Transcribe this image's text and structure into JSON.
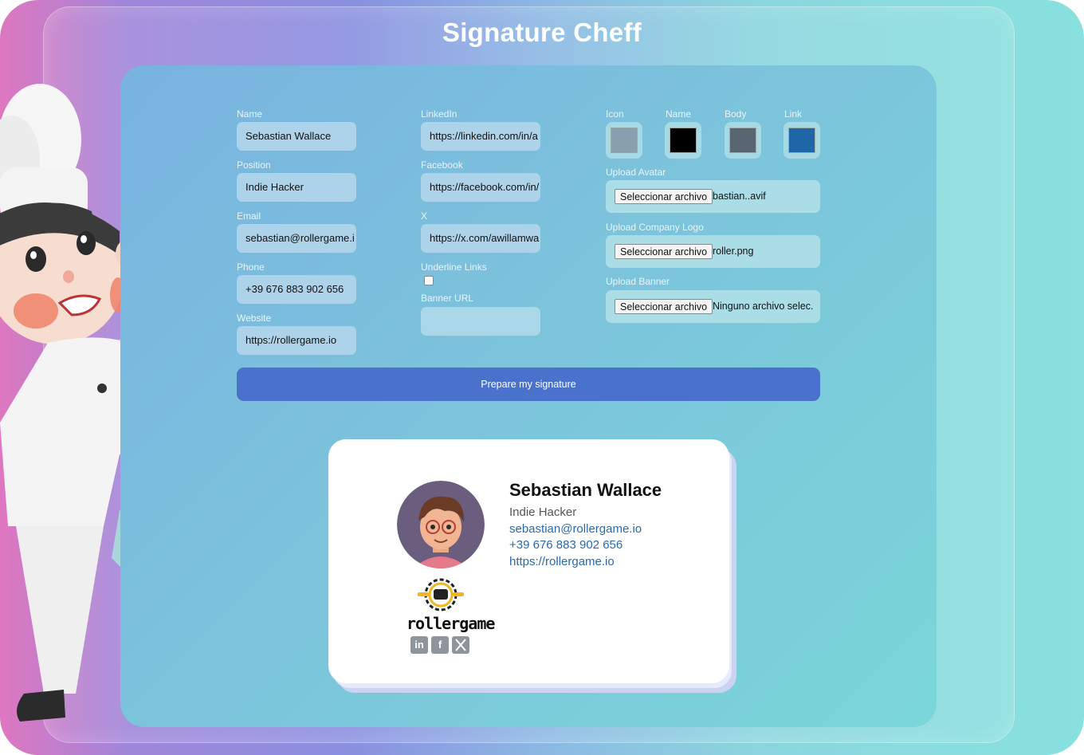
{
  "app": {
    "title": "Signature Cheff"
  },
  "form": {
    "name": {
      "label": "Name",
      "value": "Sebastian Wallace"
    },
    "position": {
      "label": "Position",
      "value": "Indie Hacker"
    },
    "email": {
      "label": "Email",
      "value": "sebastian@rollergame.i"
    },
    "phone": {
      "label": "Phone",
      "value": "+39 676 883 902 656"
    },
    "website": {
      "label": "Website",
      "value": "https://rollergame.io"
    },
    "linkedin": {
      "label": "LinkedIn",
      "value": "https://linkedin.com/in/a"
    },
    "facebook": {
      "label": "Facebook",
      "value": "https://facebook.com/in/"
    },
    "x": {
      "label": "X",
      "value": "https://x.com/awillamwa"
    },
    "underline_links": {
      "label": "Underline Links",
      "checked": false
    },
    "banner_url": {
      "label": "Banner URL",
      "value": ""
    },
    "colors": {
      "icon": {
        "label": "Icon",
        "value": "#8a9fae"
      },
      "name": {
        "label": "Name",
        "value": "#000000"
      },
      "body": {
        "label": "Body",
        "value": "#596570"
      },
      "link": {
        "label": "Link",
        "value": "#1f66a8"
      }
    },
    "upload_avatar": {
      "label": "Upload Avatar",
      "button": "Seleccionar archivo",
      "file": "bastian..avif"
    },
    "upload_logo": {
      "label": "Upload Company Logo",
      "button": "Seleccionar archivo",
      "file": "roller.png"
    },
    "upload_banner": {
      "label": "Upload Banner",
      "button": "Seleccionar archivo",
      "file": "Ninguno archivo selec."
    },
    "submit_label": "Prepare my signature"
  },
  "signature": {
    "name": "Sebastian Wallace",
    "position": "Indie Hacker",
    "email": "sebastian@rollergame.io",
    "phone": "+39 676 883 902 656",
    "website": "https://rollergame.io",
    "logo_text": "rollergame",
    "social_icons": [
      "linkedin-icon",
      "facebook-icon",
      "x-icon"
    ]
  }
}
